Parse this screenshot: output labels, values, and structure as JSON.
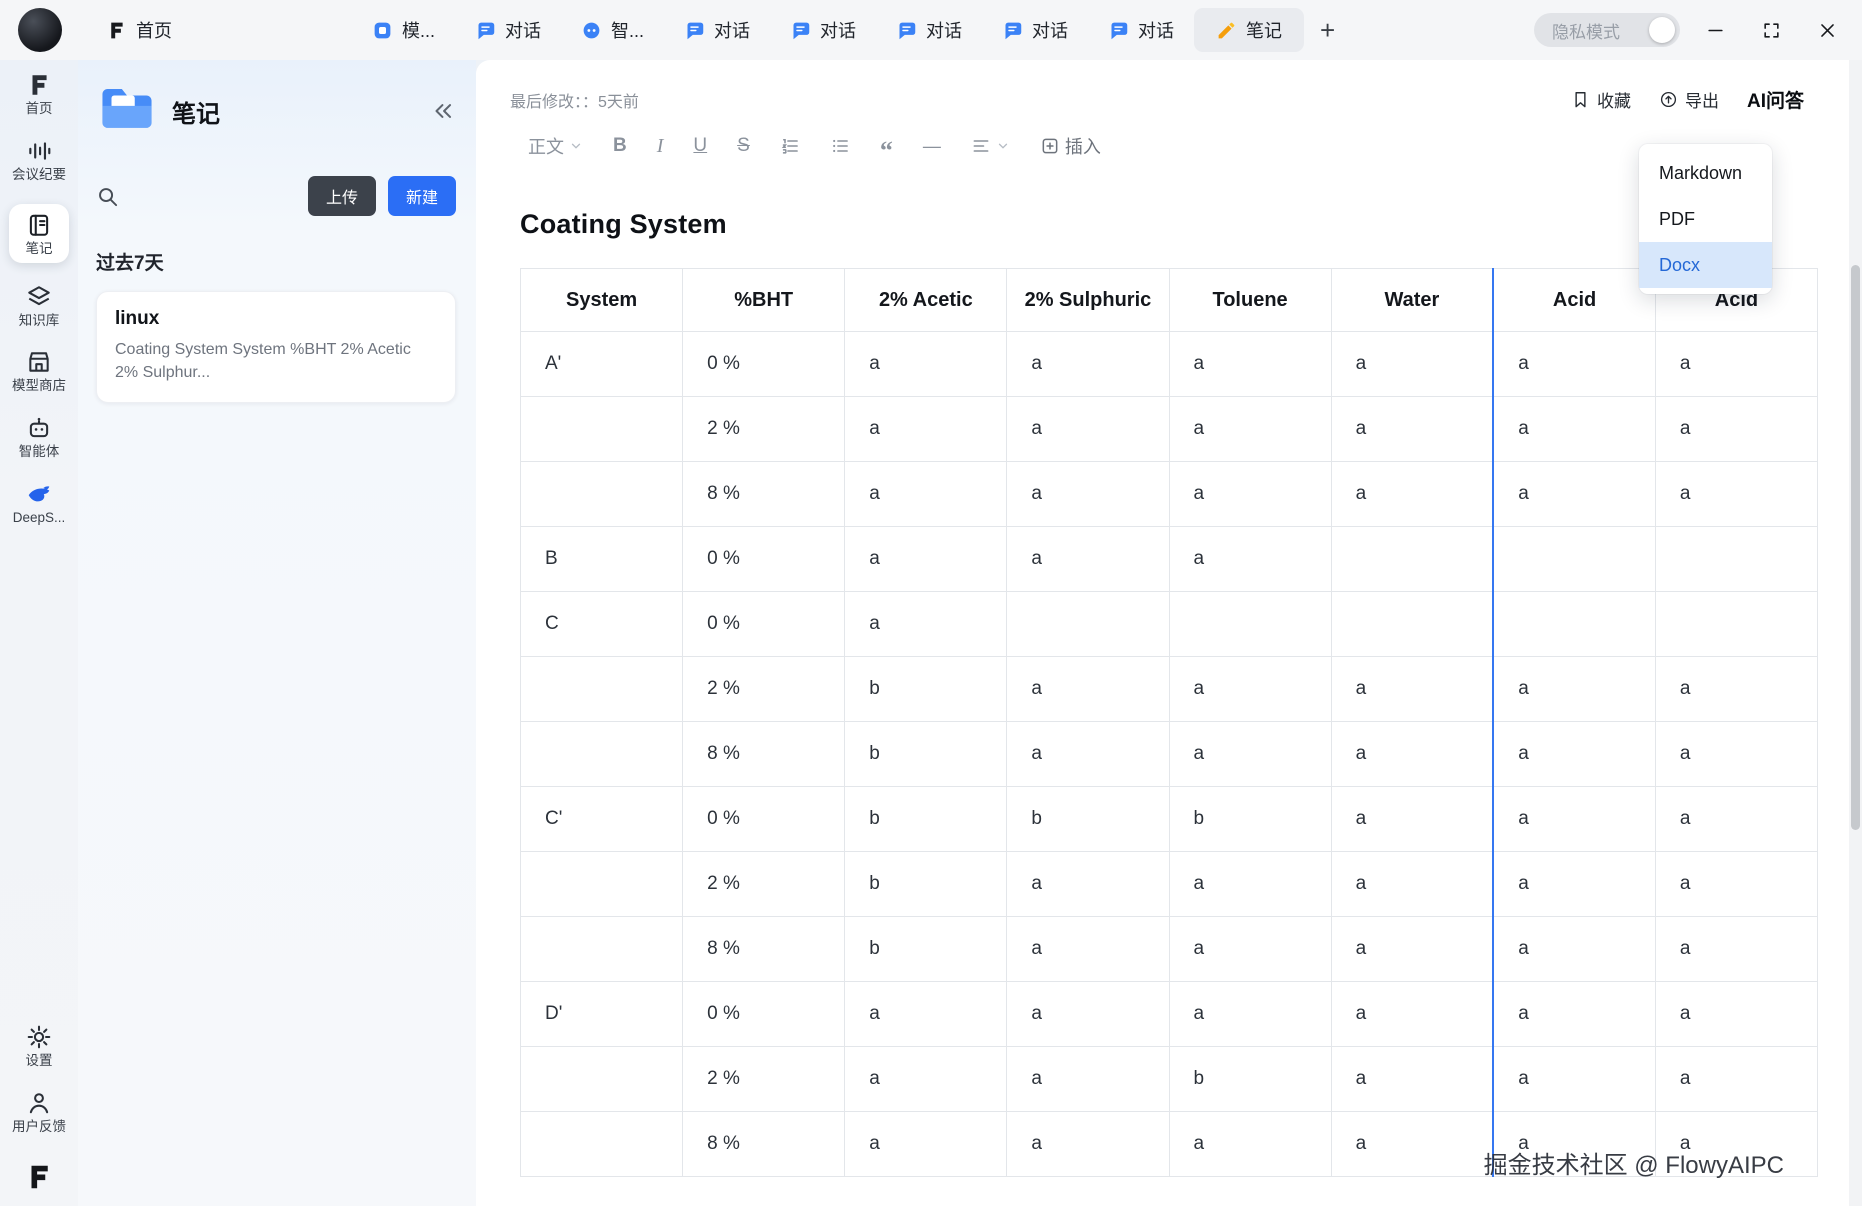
{
  "titlebar": {
    "tabs": [
      {
        "label": "首页"
      },
      {
        "label": "模..."
      },
      {
        "label": "对话"
      },
      {
        "label": "智..."
      },
      {
        "label": "对话"
      },
      {
        "label": "对话"
      },
      {
        "label": "对话"
      },
      {
        "label": "对话"
      },
      {
        "label": "对话"
      },
      {
        "label": "笔记"
      }
    ],
    "new_tab": "+",
    "privacy_mode": "隐私模式"
  },
  "rail": {
    "items": [
      {
        "label": "首页"
      },
      {
        "label": "会议纪要"
      },
      {
        "label": "笔记"
      },
      {
        "label": "知识库"
      },
      {
        "label": "模型商店"
      },
      {
        "label": "智能体"
      },
      {
        "label": "DeepS..."
      }
    ],
    "bottom": [
      {
        "label": "设置"
      },
      {
        "label": "用户反馈"
      }
    ]
  },
  "panel": {
    "title": "笔记",
    "upload": "上传",
    "create": "新建",
    "section": "过去7天",
    "note": {
      "title": "linux",
      "preview": "Coating System System %BHT 2% Acetic 2% Sulphur..."
    }
  },
  "editor": {
    "last_modified": "最后修改：：5天前",
    "favorite": "收藏",
    "export": "导出",
    "ai_qa": "AI问答",
    "toolbar": {
      "paragraph": "正文",
      "bold": "B",
      "italic": "I",
      "underline": "U",
      "strike": "S",
      "quote": "“",
      "hr": "—",
      "insert": "插入"
    },
    "title": "Coating System"
  },
  "export_menu": {
    "items": [
      "Markdown",
      "PDF",
      "Docx"
    ],
    "selected": "Docx"
  },
  "table": {
    "headers": [
      "System",
      "%BHT",
      "2% Acetic",
      "2% Sulphuric",
      "Toluene",
      "Water",
      "Acid",
      "Acid"
    ],
    "highlighted_column": 6,
    "rows": [
      [
        "A'",
        "0 %",
        "a",
        "a",
        "a",
        "a",
        "a",
        "a"
      ],
      [
        "",
        "2 %",
        "a",
        "a",
        "a",
        "a",
        "a",
        "a"
      ],
      [
        "",
        "8 %",
        "a",
        "a",
        "a",
        "a",
        "a",
        "a"
      ],
      [
        "B",
        "0 %",
        "a",
        "a",
        "a",
        "",
        "",
        ""
      ],
      [
        "C",
        "0 %",
        "a",
        "",
        "",
        "",
        "",
        ""
      ],
      [
        "",
        "2 %",
        "b",
        "a",
        "a",
        "a",
        "a",
        "a"
      ],
      [
        "",
        "8 %",
        "b",
        "a",
        "a",
        "a",
        "a",
        "a"
      ],
      [
        "C'",
        "0 %",
        "b",
        "b",
        "b",
        "a",
        "a",
        "a"
      ],
      [
        "",
        "2 %",
        "b",
        "a",
        "a",
        "a",
        "a",
        "a"
      ],
      [
        "",
        "8 %",
        "b",
        "a",
        "a",
        "a",
        "a",
        "a"
      ],
      [
        "D'",
        "0 %",
        "a",
        "a",
        "a",
        "a",
        "a",
        "a"
      ],
      [
        "",
        "2 %",
        "a",
        "a",
        "b",
        "a",
        "a",
        "a"
      ],
      [
        "",
        "8 %",
        "a",
        "a",
        "a",
        "a",
        "a",
        "a"
      ]
    ]
  },
  "watermark": "掘金技术社区 @ FlowyAIPC",
  "colors": {
    "accent_blue": "#2b6ef5",
    "column_highlight": "#3577f1",
    "menu_selected_bg": "#d7e7fb",
    "menu_selected_text": "#2468d6"
  }
}
